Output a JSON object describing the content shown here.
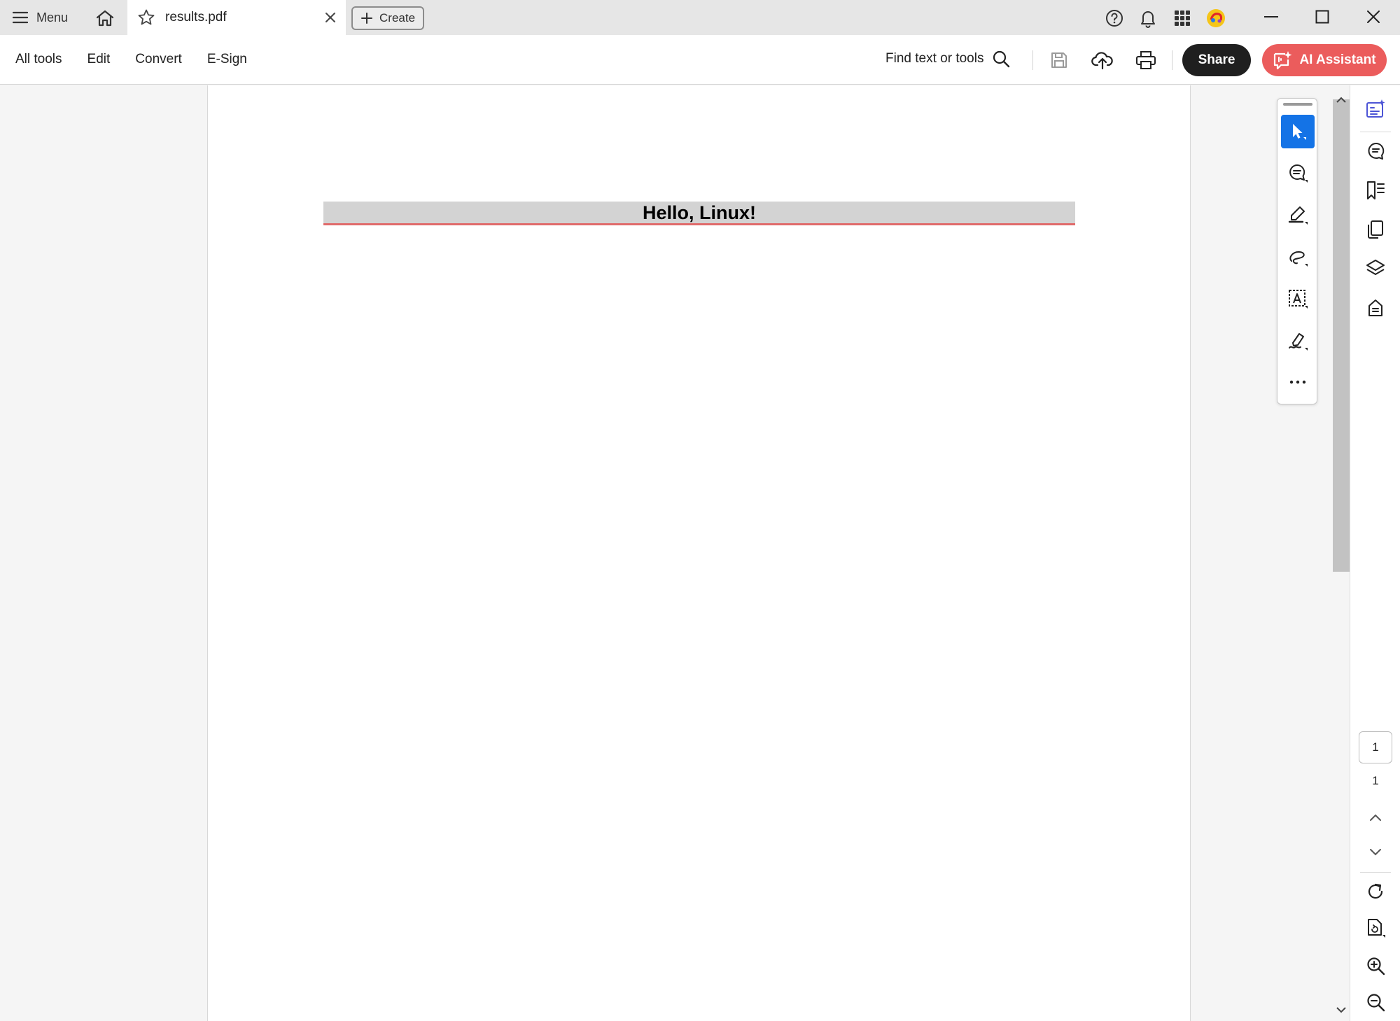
{
  "titlebar": {
    "menu_label": "Menu",
    "tab_title": "results.pdf",
    "create_label": "Create"
  },
  "toolbar": {
    "nav": [
      "All tools",
      "Edit",
      "Convert",
      "E-Sign"
    ],
    "find_label": "Find text or tools",
    "share_label": "Share",
    "ai_label": "AI Assistant"
  },
  "document": {
    "heading": "Hello, Linux!"
  },
  "navigation": {
    "current_page": "1",
    "total_pages": "1"
  },
  "colors": {
    "accent_blue": "#1473e6",
    "ai_button": "#eb5c5c",
    "share_button": "#1f1f1f",
    "heading_bg": "#d3d3d3",
    "heading_underline": "#e06a6a"
  },
  "icons": {
    "titlebar": [
      "hamburger-icon",
      "home-icon",
      "star-icon",
      "close-icon",
      "plus-icon",
      "help-icon",
      "bell-icon",
      "apps-grid-icon",
      "profile-avatar-icon",
      "minimize-icon",
      "maximize-icon",
      "window-close-icon"
    ],
    "toolbar": [
      "search-icon",
      "save-icon",
      "cloud-upload-icon",
      "print-icon",
      "ai-assistant-icon"
    ],
    "annotation_tools": [
      "select-cursor-icon",
      "comment-icon",
      "highlight-pen-icon",
      "freehand-draw-icon",
      "text-box-icon",
      "signature-icon",
      "more-options-icon"
    ],
    "right_rail": [
      "ai-summary-icon",
      "comments-panel-icon",
      "bookmarks-icon",
      "pages-icon",
      "layers-icon",
      "document-properties-icon",
      "page-up-icon",
      "page-down-icon",
      "rotate-icon",
      "page-tools-icon",
      "zoom-in-icon",
      "zoom-out-icon"
    ]
  }
}
